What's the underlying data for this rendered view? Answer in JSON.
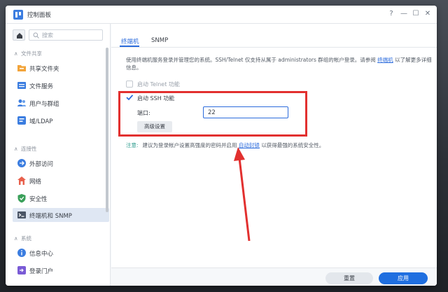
{
  "window": {
    "title": "控制面板",
    "help_glyph": "?",
    "minimize_glyph": "—",
    "maximize_glyph": "☐",
    "close_glyph": "✕"
  },
  "sidebar": {
    "search_placeholder": "搜索",
    "groups": [
      {
        "label": "文件共享",
        "items": [
          "共享文件夹",
          "文件服务",
          "用户与群组",
          "域/LDAP"
        ]
      },
      {
        "label": "连接性",
        "items": [
          "外部访问",
          "网络",
          "安全性",
          "终端机和 SNMP"
        ]
      },
      {
        "label": "系统",
        "items": [
          "信息中心",
          "登录门户"
        ]
      }
    ],
    "active_item": "终端机和 SNMP"
  },
  "main": {
    "tabs": [
      "终端机",
      "SNMP"
    ],
    "active_tab": "终端机",
    "description_pre": "使用终端机服务登录并管理您的系统。SSH/Telnet 仅支持从属于 administrators 群组的帐户登录。请参阅",
    "description_link": "终端机",
    "description_post": "以了解更多详细信息。",
    "telnet_label": "启动 Telnet 功能",
    "telnet_checked": false,
    "ssh_label": "启动 SSH 功能",
    "ssh_checked": true,
    "port_label": "端口:",
    "port_value": "22",
    "advanced_label": "高级设置",
    "note_tag": "注意:",
    "note_pre": "建议为登录帐户设置高强度的密码并启用",
    "note_link": "自动封锁",
    "note_post": "以获得最强的系统安全性。"
  },
  "footer": {
    "reset_label": "重置",
    "apply_label": "应用"
  },
  "colors": {
    "accent": "#2b6bdc",
    "apply": "#1f6fe0",
    "annotation": "#e2302f",
    "note_tag": "#2f9d8f"
  }
}
